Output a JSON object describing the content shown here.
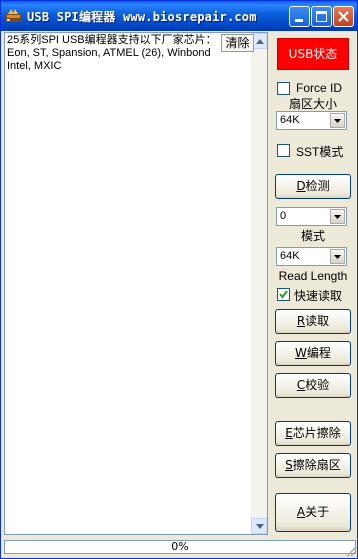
{
  "window": {
    "title": "USB SPI编程器 www.biosrepair.com"
  },
  "log": {
    "text": "25系列SPI USB编程器支持以下厂家芯片：\nEon, ST, Spansion, ATMEL (26), Winbond\nIntel, MXIC",
    "clear_label": "清除"
  },
  "panel": {
    "status_label": "USB状态",
    "status_color": "#ff0000",
    "force_id": {
      "label": "Force ID",
      "checked": false
    },
    "sector_size_label": "扇区大小",
    "sector_size_value": "64K",
    "sst_mode": {
      "label": "SST模式",
      "checked": false
    },
    "detect_hotkey": "D",
    "detect_label": "检测",
    "mode_value": "0",
    "mode_label": "模式",
    "read_length_value": "64K",
    "read_length_label": "Read Length",
    "fast_read": {
      "label": "快速读取",
      "checked": true
    },
    "read_hotkey": "R",
    "read_label": "读取",
    "write_hotkey": "W",
    "write_label": "编程",
    "verify_hotkey": "C",
    "verify_label": "校验",
    "erase_chip_hotkey": "E",
    "erase_chip_label": "芯片擦除",
    "erase_sector_hotkey": "S",
    "erase_sector_label": "擦除扇区",
    "about_hotkey": "A",
    "about_label": "关于"
  },
  "progress": {
    "percent": 0,
    "text": "0%"
  }
}
